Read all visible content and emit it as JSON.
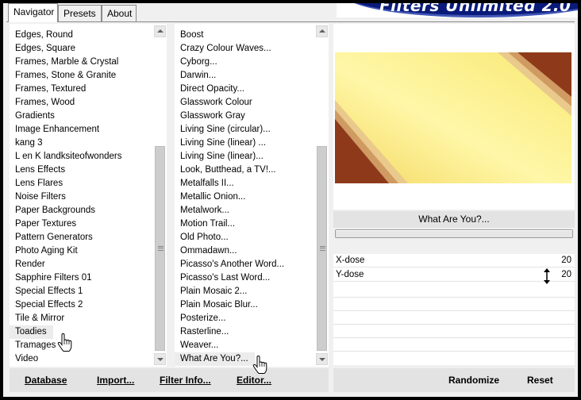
{
  "tabs": [
    {
      "label": "Navigator",
      "active": true
    },
    {
      "label": "Presets",
      "active": false
    },
    {
      "label": "About",
      "active": false
    }
  ],
  "banner": {
    "title": "Filters Unlimited 2.0"
  },
  "categories": {
    "items": [
      "Edges, Round",
      "Edges, Square",
      "Frames, Marble & Crystal",
      "Frames, Stone & Granite",
      "Frames, Textured",
      "Frames, Wood",
      "Gradients",
      "Image Enhancement",
      "kang 3",
      "L en K landksiteofwonders",
      "Lens Effects",
      "Lens Flares",
      "Noise Filters",
      "Paper Backgrounds",
      "Paper Textures",
      "Pattern Generators",
      "Photo Aging Kit",
      "Render",
      "Sapphire Filters 01",
      "Special Effects 1",
      "Special Effects 2",
      "Tile & Mirror",
      "Toadies",
      "Tramages",
      "Video"
    ],
    "selected": "Toadies"
  },
  "filters": {
    "items": [
      "Boost",
      "Crazy Colour Waves...",
      "Cyborg...",
      "Darwin...",
      "Direct Opacity...",
      "Glasswork Colour",
      "Glasswork Gray",
      "Living Sine (circular)...",
      "Living Sine (linear) ...",
      "Living Sine (linear)...",
      "Look, Butthead, a TV!...",
      "Metalfalls II...",
      "Metallic Onion...",
      "Metalwork...",
      "Motion Trail...",
      "Old Photo...",
      "Ommadawn...",
      "Picasso's Another Word...",
      "Picasso's Last Word...",
      "Plain Mosaic 2...",
      "Plain Mosaic Blur...",
      "Posterize...",
      "Rasterline...",
      "Weaver...",
      "What Are You?..."
    ],
    "selected": "What Are You?..."
  },
  "preview": {
    "colors": {
      "rust": "#8e3a1a",
      "yellow": "#f7e46a",
      "pale": "#fff7a0",
      "tan": "#d9a068"
    }
  },
  "current_filter": "What Are You?...",
  "params": [
    {
      "label": "X-dose",
      "value": "20"
    },
    {
      "label": "Y-dose",
      "value": "20"
    }
  ],
  "buttons": {
    "database": "Database",
    "import": "Import...",
    "filter_info": "Filter Info...",
    "editor": "Editor...",
    "randomize": "Randomize",
    "reset": "Reset"
  }
}
